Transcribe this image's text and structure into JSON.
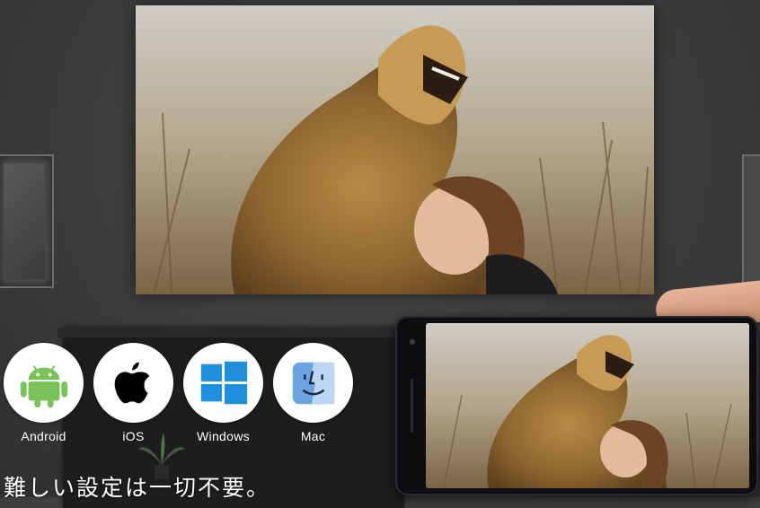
{
  "os_list": [
    {
      "label": "Android",
      "icon": "android-icon",
      "color": "#78c257"
    },
    {
      "label": "iOS",
      "icon": "apple-icon",
      "color": "#000000"
    },
    {
      "label": "Windows",
      "icon": "windows-icon",
      "color": "#1e90dc"
    },
    {
      "label": "Mac",
      "icon": "mac-finder-icon",
      "color": "#6ba3e3"
    }
  ],
  "caption": "難しい設定は一切不要。",
  "colors": {
    "background": "#3f3e3e",
    "text": "#ffffff",
    "phone_body": "#0d0d10"
  }
}
